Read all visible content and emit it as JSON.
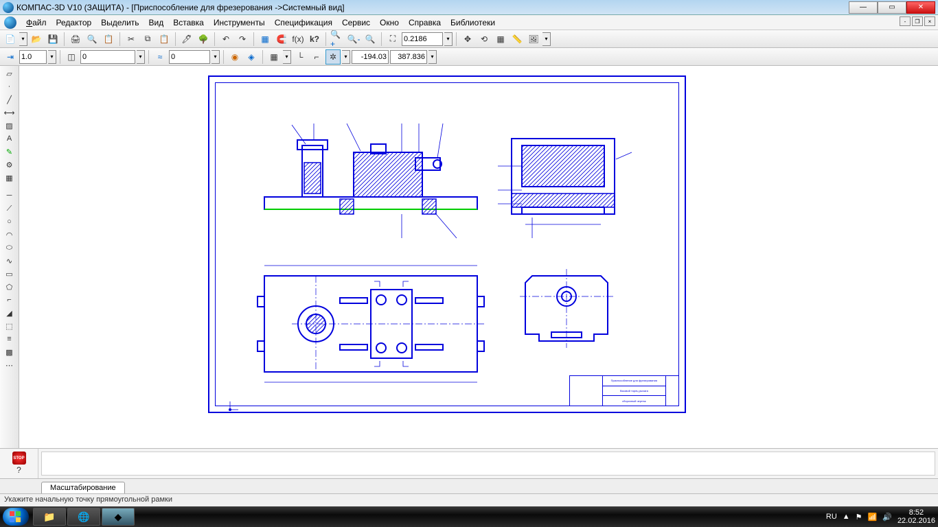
{
  "titlebar": {
    "text": "КОМПАС-3D V10 (ЗАЩИТА) - [Приспособление для фрезерования ->Системный вид]"
  },
  "menu": {
    "file": "Файл",
    "edit": "Редактор",
    "select": "Выделить",
    "view": "Вид",
    "insert": "Вставка",
    "tools": "Инструменты",
    "spec": "Спецификация",
    "service": "Сервис",
    "window": "Окно",
    "help": "Справка",
    "libs": "Библиотеки"
  },
  "toolbar1": {
    "zoom_value": "0.2186"
  },
  "toolbar2": {
    "state1": "1.0",
    "state2": "0",
    "state3": "0",
    "coord_x": "-194.03",
    "coord_y": "387.836"
  },
  "titleblock": {
    "line1": "Приспособление для фрезерования",
    "line2": "боковой торец рычага",
    "line3": "сборочный чертеж"
  },
  "tabs": {
    "active": "Масштабирование"
  },
  "statusbar": {
    "hint": "Укажите начальную точку прямоугольной рамки"
  },
  "tray": {
    "lang": "RU",
    "time": "8:52",
    "date": "22.02.2016"
  }
}
